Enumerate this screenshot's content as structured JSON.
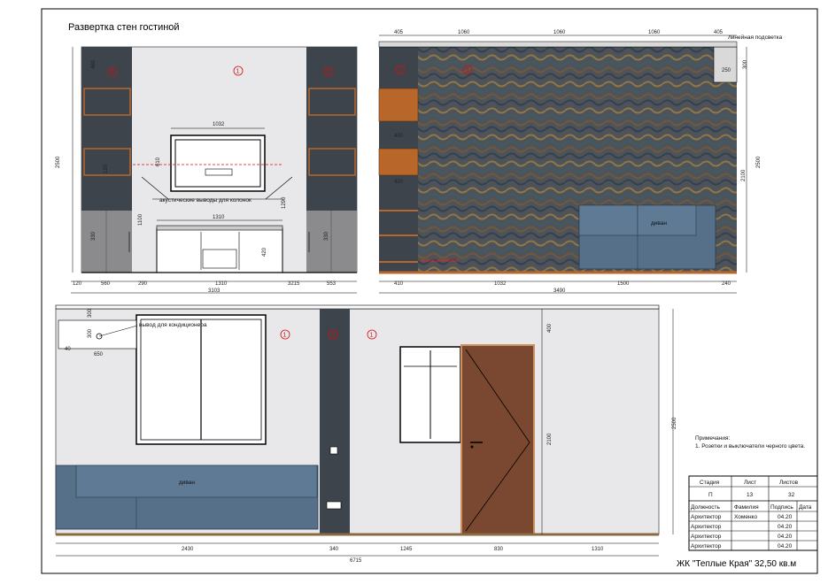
{
  "sheet": {
    "title": "Развертка стен гостиной",
    "project": "ЖК \"Теплые Края\" 32,50 кв.м"
  },
  "colors": {
    "dark_panel": "#3e444c",
    "light_wall": "#e8e7e9",
    "wood": "#b8662a",
    "door": "#7a4830",
    "sofa": "#56708a",
    "marker": "#d01010"
  },
  "wall1": {
    "markers": [
      "2",
      "1",
      "2"
    ],
    "dims_top": [
      "1032"
    ],
    "dims_left": [
      "460",
      "120",
      "1100",
      "330",
      "2500"
    ],
    "dims_tv": [
      "610",
      "1310",
      "1290",
      "420",
      "330"
    ],
    "dims_bottom": [
      "120",
      "560",
      "290",
      "1310",
      "3215",
      "553"
    ],
    "total_bottom": "3103",
    "note_acoustic": "акустические выводы для колонок"
  },
  "wall2": {
    "markers": [
      "2",
      "3"
    ],
    "dims_top": [
      "405",
      "1060",
      "1060",
      "1060",
      "405"
    ],
    "dims_right": [
      "300",
      "2100",
      "2500"
    ],
    "dims_left": [
      "400",
      "420"
    ],
    "dims_bottom": [
      "410",
      "1032",
      "1500",
      "240"
    ],
    "total_bottom": "3490",
    "label_light": "линейная подсветка",
    "label_250": "250",
    "sofa_label": "диван",
    "red_note": "выход электрики"
  },
  "wall3": {
    "markers": [
      "1",
      "2",
      "1"
    ],
    "dims_left": [
      "300",
      "300",
      "40",
      "650"
    ],
    "dims_right": [
      "400",
      "2100",
      "2500"
    ],
    "dims_bottom": [
      "2430",
      "340",
      "1245",
      "830",
      "1310"
    ],
    "total_bottom": "6715",
    "label_ac": "вывод для кондиционера",
    "sofa_label": "диван",
    "note_title": "Примечания:",
    "note_1": "1. Розетки и выключатели черного цвета."
  },
  "title_block": {
    "headers": [
      "Стадия",
      "Лист",
      "Листов"
    ],
    "values": [
      "П",
      "13",
      "32"
    ],
    "cols": [
      "Должность",
      "Фамилия",
      "Подпись",
      "Дата"
    ],
    "rows": [
      [
        "Архитектор",
        "Хоменко",
        "04.20",
        ""
      ],
      [
        "Архитектор",
        "",
        "04.20",
        ""
      ],
      [
        "Архитектор",
        "",
        "04.20",
        ""
      ],
      [
        "Архитектор",
        "",
        "04.20",
        ""
      ]
    ]
  }
}
